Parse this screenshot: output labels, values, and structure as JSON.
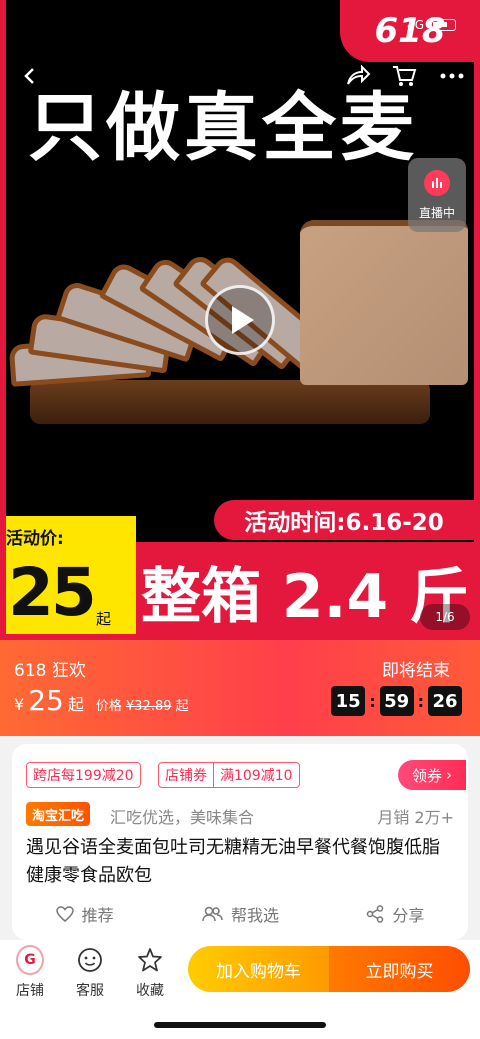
{
  "status_bar": {
    "network": "4G"
  },
  "hero": {
    "badge": "618",
    "headline": "只做真全麦",
    "live_label": "直播中",
    "event_time": "活动时间:6.16-20",
    "price_label": "活动价:",
    "price_value": "25",
    "price_suffix": "起",
    "promo_text": "整箱 2.4 斤",
    "image_counter": "1/6",
    "icons": {
      "back": "back-icon",
      "share": "share-icon",
      "cart": "cart-icon",
      "more": "more-icon",
      "play": "play-icon"
    }
  },
  "sale_bar": {
    "campaign": "618 狂欢",
    "currency": "¥",
    "price": "25",
    "price_suffix": "起",
    "orig_label": "价格",
    "orig_price": "¥32.89",
    "orig_suffix": "起",
    "ending_label": "即将结束",
    "timer": {
      "h": "15",
      "m": "59",
      "s": "26"
    }
  },
  "product": {
    "coupons": {
      "cross_store": "跨店每199减20",
      "store_coupon_label": "店铺券",
      "store_coupon_value": "满109减10"
    },
    "claim_button": "领券",
    "tag": "淘宝汇吃",
    "slogan": "汇吃优选，美味集合",
    "monthly_sales": "月销 2万+",
    "title": "遇见谷语全麦面包吐司无糖精无油早餐代餐饱腹低脂健康零食品欧包",
    "actions": {
      "recommend": "推荐",
      "help_choose": "帮我选",
      "share": "分享"
    }
  },
  "bottom_bar": {
    "store": "店铺",
    "service": "客服",
    "favorite": "收藏",
    "add_to_cart": "加入购物车",
    "buy_now": "立即购买"
  },
  "colors": {
    "brand_red": "#e4173d",
    "yellow": "#ffe600",
    "orange": "#ff6a33"
  }
}
